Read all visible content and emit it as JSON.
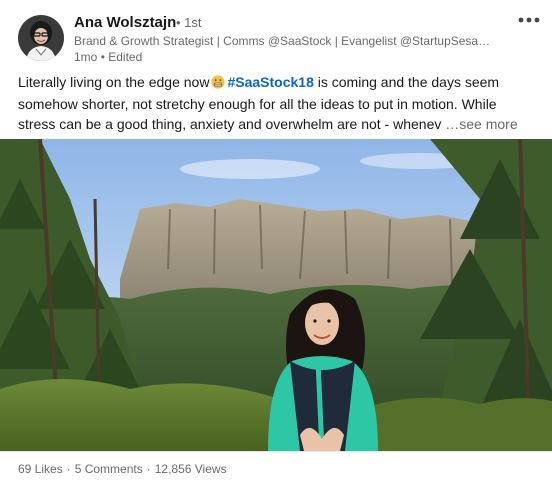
{
  "post": {
    "author": {
      "name": "Ana Wolsztajn",
      "degree": "• 1st",
      "headline": "Brand & Growth Strategist | Comms @SaaStock | Evangelist @StartupSesa…",
      "time": "1mo",
      "edited": "• Edited"
    },
    "text": {
      "line1_before": "Literally living on the edge now",
      "hashtag": "#SaaStock18",
      "line1_after": "is coming and the days seem",
      "line2": "somehow shorter, not stretchy enough for all the ideas to put in motion. While",
      "line3": "stress can be a good thing, anxiety and overwhelm are not - whenev",
      "see_more": "…see more"
    },
    "icons": {
      "emoji": "grimacing-face",
      "menu": "more-horizontal-icon"
    },
    "stats": {
      "likes": "69 Likes",
      "comments": "5 Comments",
      "views": "12,856 Views",
      "separator": "·"
    }
  },
  "colors": {
    "link": "#0a66c2",
    "secondary_text": "#666666"
  }
}
